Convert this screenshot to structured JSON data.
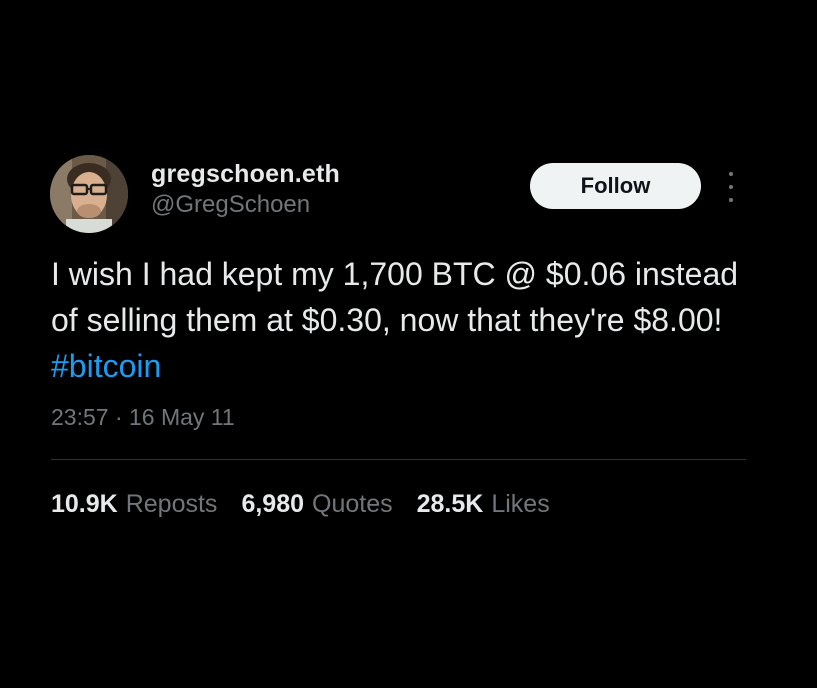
{
  "author": {
    "display_name": "gregschoen.eth",
    "handle": "@GregSchoen",
    "avatar_icon": "profile-photo"
  },
  "follow_button": {
    "label": "Follow"
  },
  "more_menu": {
    "icon": "more-vertical-icon"
  },
  "tweet": {
    "text_before_hashtag": "I wish I had kept my 1,700 BTC @ $0.06 instead of selling them at $0.30, now that they're $8.00! ",
    "hashtag": "#bitcoin",
    "timestamp": "23:57 · 16 May 11"
  },
  "stats": {
    "reposts_value": "10.9K",
    "reposts_label": "Reposts",
    "quotes_value": "6,980",
    "quotes_label": "Quotes",
    "likes_value": "28.5K",
    "likes_label": "Likes"
  },
  "colors": {
    "background": "#000000",
    "text_primary": "#e7e9ea",
    "text_secondary": "#71767b",
    "link": "#1d9bf0",
    "follow_button_bg": "#eff3f4",
    "divider": "#2f3336"
  }
}
